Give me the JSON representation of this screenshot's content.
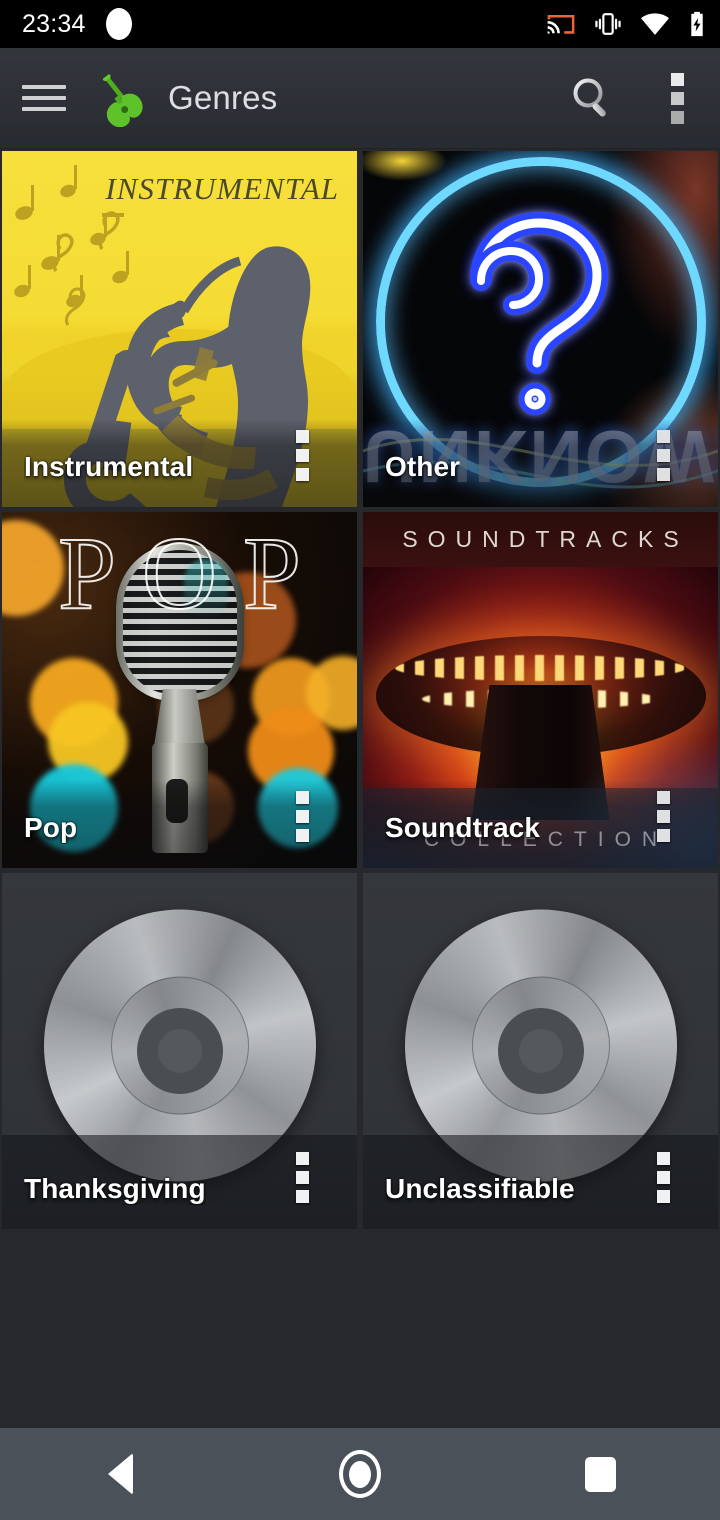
{
  "status_bar": {
    "time": "23:34",
    "icons": [
      "camera-dot",
      "cast-icon",
      "vibrate-icon",
      "wifi-icon",
      "battery-charging-icon"
    ]
  },
  "app_bar": {
    "menu_icon": "hamburger-menu-icon",
    "logo_icon": "guitar-icon",
    "title": "Genres",
    "search_icon": "search-icon",
    "overflow_icon": "overflow-menu-icon"
  },
  "grid": {
    "tiles": [
      {
        "label": "Instrumental",
        "artwork_text": "INSTRUMENTAL",
        "art": "saxophone-player-yellow",
        "overflow_icon": "overflow-menu-icon"
      },
      {
        "label": "Other",
        "artwork_text": "UNKNOWN",
        "art": "neon-question-mark",
        "overflow_icon": "overflow-menu-icon"
      },
      {
        "label": "Pop",
        "artwork_text": "POP",
        "art": "vintage-microphone-bokeh",
        "overflow_icon": "overflow-menu-icon"
      },
      {
        "label": "Soundtrack",
        "artwork_text_top": "SOUNDTRACKS",
        "artwork_text_bottom": "COLLECTION",
        "art": "ufo-spaceship",
        "overflow_icon": "overflow-menu-icon"
      },
      {
        "label": "Thanksgiving",
        "art": "placeholder-disc",
        "overflow_icon": "overflow-menu-icon"
      },
      {
        "label": "Unclassifiable",
        "art": "placeholder-disc",
        "overflow_icon": "overflow-menu-icon"
      }
    ]
  },
  "nav_bar": {
    "back": "back-nav-icon",
    "home": "home-nav-icon",
    "recents": "recents-nav-icon"
  },
  "colors": {
    "accent_green": "#5ec22a",
    "cast_orange": "#f4623a",
    "app_bar_bg": "#2d3036",
    "page_bg": "#26282c",
    "nav_bar_bg": "#4a5158"
  }
}
